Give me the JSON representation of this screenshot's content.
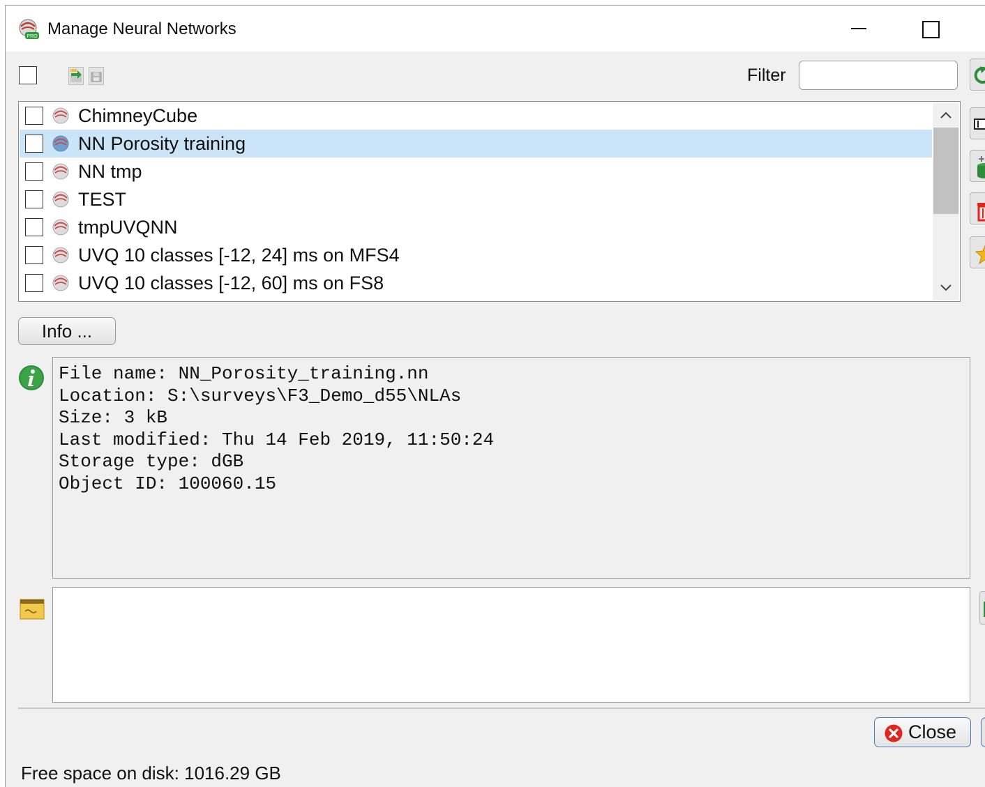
{
  "window": {
    "title": "Manage Neural Networks",
    "icon": "opendtect-pro-icon",
    "controls": [
      "minimize",
      "maximize"
    ]
  },
  "toolbar": {
    "select_all_checked": false,
    "icons": [
      "import-icon",
      "save-icon"
    ],
    "filter_label": "Filter",
    "filter_value": ""
  },
  "list": {
    "items": [
      {
        "label": "ChimneyCube",
        "checked": false,
        "selected": false
      },
      {
        "label": "NN Porosity training",
        "checked": false,
        "selected": true
      },
      {
        "label": "NN tmp",
        "checked": false,
        "selected": false
      },
      {
        "label": "TEST",
        "checked": false,
        "selected": false
      },
      {
        "label": "tmpUVQNN",
        "checked": false,
        "selected": false
      },
      {
        "label": "UVQ 10 classes [-12, 24] ms on MFS4",
        "checked": false,
        "selected": false
      },
      {
        "label": "UVQ 10 classes [-12, 60] ms on FS8",
        "checked": false,
        "selected": false
      }
    ]
  },
  "side_toolbar": {
    "icons": [
      "refresh-icon",
      "rename-icon",
      "copy-to-database-icon",
      "delete-icon",
      "set-default-icon"
    ]
  },
  "info_button": {
    "label": "Info ..."
  },
  "info_panel": {
    "lines": [
      "File name: NN_Porosity_training.nn",
      "Location: S:\\surveys\\F3_Demo_d55\\NLAs",
      "Size: 3 kB",
      "Last modified: Thu 14 Feb 2019, 11:50:24",
      "",
      "Storage type: dGB",
      "Object ID: 100060.15"
    ]
  },
  "notes": {
    "value": "",
    "icon": "notes-icon"
  },
  "buttons": {
    "close_label": "Close"
  },
  "status": {
    "text": "Free space on disk: 1016.29 GB"
  },
  "colors": {
    "selection": "#cce4f7",
    "window_bg": "#f0f0f0",
    "close_button_border": "#4a78b8",
    "delete_red": "#e0261e"
  }
}
